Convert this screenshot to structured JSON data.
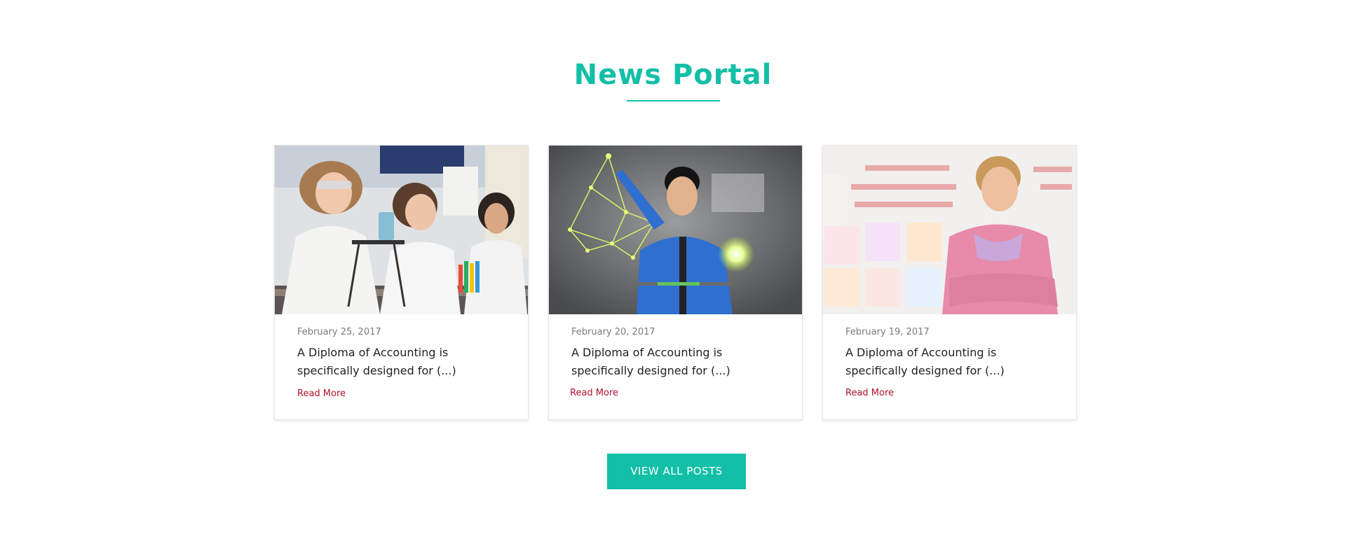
{
  "section": {
    "title": "News Portal",
    "accent_color": "#13bfa6",
    "link_color": "#b0122b"
  },
  "posts": [
    {
      "date": "February 25, 2017",
      "excerpt": "A Diploma of Accounting is specifically designed for (...)",
      "read_more": "Read More",
      "image": "students-in-science-lab-photo"
    },
    {
      "date": "February 20, 2017",
      "excerpt": "A Diploma of Accounting is specifically designed for (...)",
      "read_more": "Read More",
      "image": "man-touching-digital-interface-photo"
    },
    {
      "date": "February 19, 2017",
      "excerpt": "A Diploma of Accounting is specifically designed for (...)",
      "read_more": "Read More",
      "image": "teacher-in-front-of-whiteboard-photo"
    }
  ],
  "view_all": {
    "label": "VIEW ALL POSTS"
  }
}
